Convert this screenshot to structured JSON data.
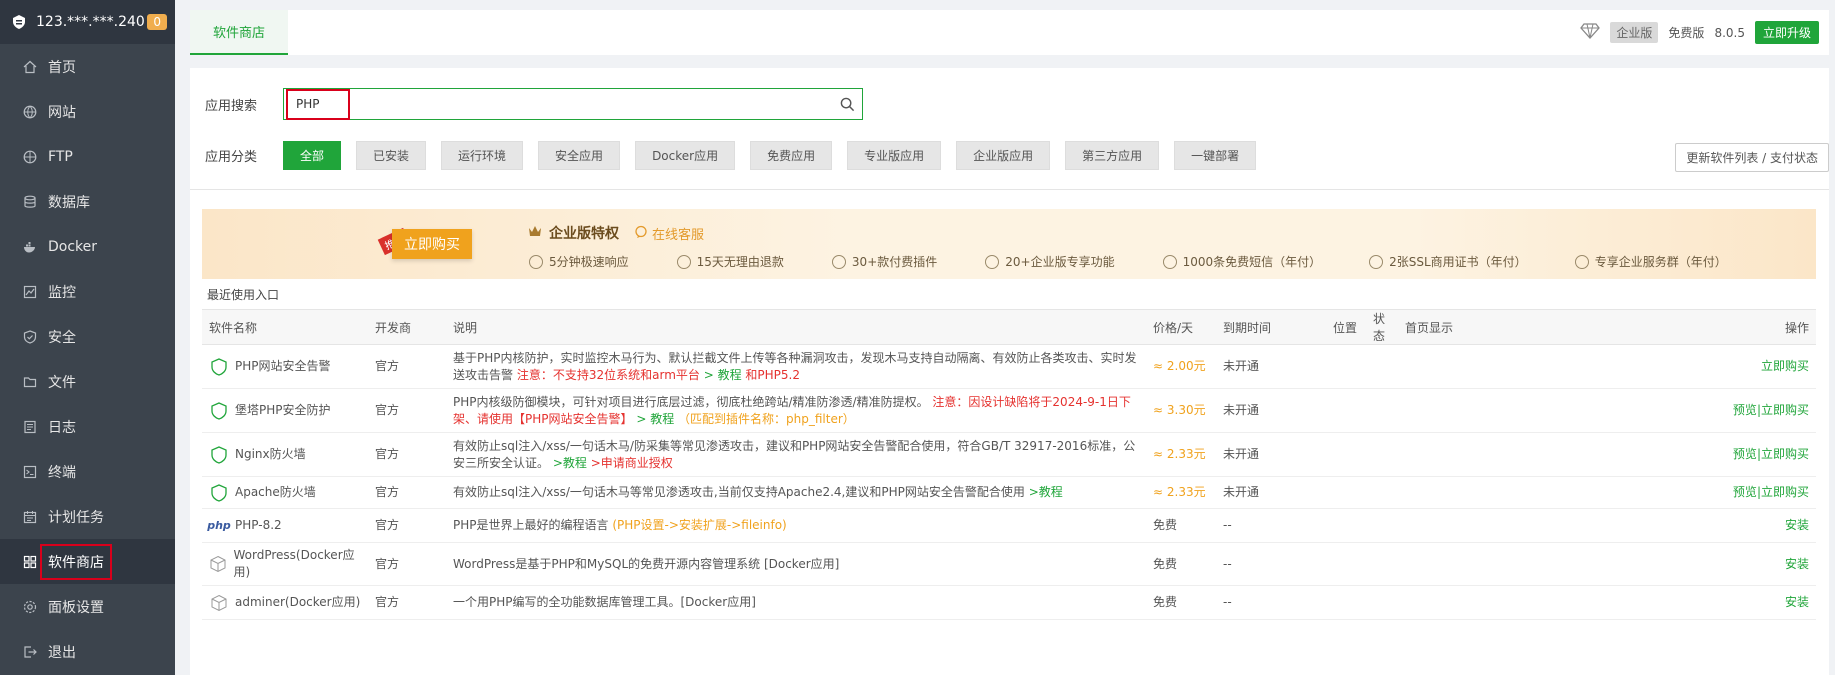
{
  "sidebar": {
    "server_ip": "123.***.***.240",
    "badge": "0",
    "items": [
      {
        "label": "首页",
        "icon": "home-icon"
      },
      {
        "label": "网站",
        "icon": "globe-icon"
      },
      {
        "label": "FTP",
        "icon": "ftp-icon"
      },
      {
        "label": "数据库",
        "icon": "database-icon"
      },
      {
        "label": "Docker",
        "icon": "docker-icon"
      },
      {
        "label": "监控",
        "icon": "monitor-icon"
      },
      {
        "label": "安全",
        "icon": "shield-icon"
      },
      {
        "label": "文件",
        "icon": "folder-icon"
      },
      {
        "label": "日志",
        "icon": "log-icon"
      },
      {
        "label": "终端",
        "icon": "terminal-icon"
      },
      {
        "label": "计划任务",
        "icon": "calendar-icon"
      },
      {
        "label": "软件商店",
        "icon": "grid-icon"
      },
      {
        "label": "面板设置",
        "icon": "gear-icon"
      },
      {
        "label": "退出",
        "icon": "logout-icon"
      }
    ]
  },
  "topbar": {
    "tab": "软件商店",
    "enterprise": "企业版",
    "free": "免费版",
    "version": "8.0.5",
    "upgrade": "立即升级"
  },
  "search": {
    "label": "应用搜索",
    "value": "PHP"
  },
  "categories": {
    "label": "应用分类",
    "items": [
      "全部",
      "已安装",
      "运行环境",
      "安全应用",
      "Docker应用",
      "免费应用",
      "专业版应用",
      "企业版应用",
      "第三方应用",
      "一键部署"
    ],
    "refresh": "更新软件列表 / 支付状态"
  },
  "banner": {
    "tag": "推荐",
    "buy": "立即购买",
    "title": "企业版特权",
    "service": "在线客服",
    "features": [
      "5分钟极速响应",
      "15天无理由退款",
      "30+款付费插件",
      "20+企业版专享功能",
      "1000条免费短信（年付）",
      "2张SSL商用证书（年付）",
      "专享企业服务群（年付）"
    ]
  },
  "recent": "最近使用入口",
  "table": {
    "headers": {
      "name": "软件名称",
      "dev": "开发商",
      "desc": "说明",
      "price": "价格/天",
      "expire": "到期时间",
      "pos": "位置",
      "status": "状态",
      "home": "首页显示",
      "op": "操作"
    },
    "rows": [
      {
        "name": "PHP网站安全告警",
        "dev": "官方",
        "desc": "基于PHP内核防护，实时监控木马行为、默认拦截文件上传等各种漏洞攻击，发现木马支持自动隔离、有效防止各类攻击、实时发送攻击告警",
        "warn": "注意：不支持32位系统和arm平台",
        "link": "> 教程",
        "warn2": "和PHP5.2",
        "price": "≈ 2.00元",
        "expire": "未开通",
        "preview": "",
        "sep": "",
        "op": "立即购买"
      },
      {
        "name": "堡塔PHP安全防护",
        "dev": "官方",
        "desc": "PHP内核级防御模块，可针对项目进行底层过滤，彻底杜绝跨站/精准防渗透/精准防提权。",
        "warn": "注意：因设计缺陷将于2024-9-1日下架、请使用【PHP网站安全告警】",
        "link": "> 教程",
        "warn2": "（匹配到插件名称：php_filter）",
        "price": "≈ 3.30元",
        "expire": "未开通",
        "preview": "预览",
        "sep": "|",
        "op": "立即购买"
      },
      {
        "name": "Nginx防火墙",
        "dev": "官方",
        "desc": "有效防止sql注入/xss/一句话木马/防采集等常见渗透攻击，建议和PHP网站安全告警配合使用，符合GB/T 32917-2016标准，公安三所安全认证。",
        "warn": "",
        "link": ">教程",
        "warn2": ">申请商业授权",
        "price": "≈ 2.33元",
        "expire": "未开通",
        "preview": "预览",
        "sep": "|",
        "op": "立即购买"
      },
      {
        "name": "Apache防火墙",
        "dev": "官方",
        "desc": "有效防止sql注入/xss/一句话木马等常见渗透攻击,当前仅支持Apache2.4,建议和PHP网站安全告警配合使用",
        "warn": "",
        "link": ">教程",
        "warn2": "",
        "price": "≈ 2.33元",
        "expire": "未开通",
        "preview": "预览",
        "sep": "|",
        "op": "立即购买"
      },
      {
        "name": "PHP-8.2",
        "dev": "官方",
        "desc": "PHP是世界上最好的编程语言",
        "warn": "",
        "link": "",
        "warn2": "(PHP设置->安装扩展->fileinfo)",
        "price": "免费",
        "expire": "--",
        "preview": "",
        "sep": "",
        "op": "安装"
      },
      {
        "name": "WordPress(Docker应用)",
        "dev": "官方",
        "desc": "WordPress是基于PHP和MySQL的免费开源内容管理系统 [Docker应用]",
        "warn": "",
        "link": "",
        "warn2": "",
        "price": "免费",
        "expire": "--",
        "preview": "",
        "sep": "",
        "op": "安装"
      },
      {
        "name": "adminer(Docker应用)",
        "dev": "官方",
        "desc": "一个用PHP编写的全功能数据库管理工具。[Docker应用]",
        "warn": "",
        "link": "",
        "warn2": "",
        "price": "免费",
        "expire": "--",
        "preview": "",
        "sep": "",
        "op": "安装"
      }
    ]
  }
}
